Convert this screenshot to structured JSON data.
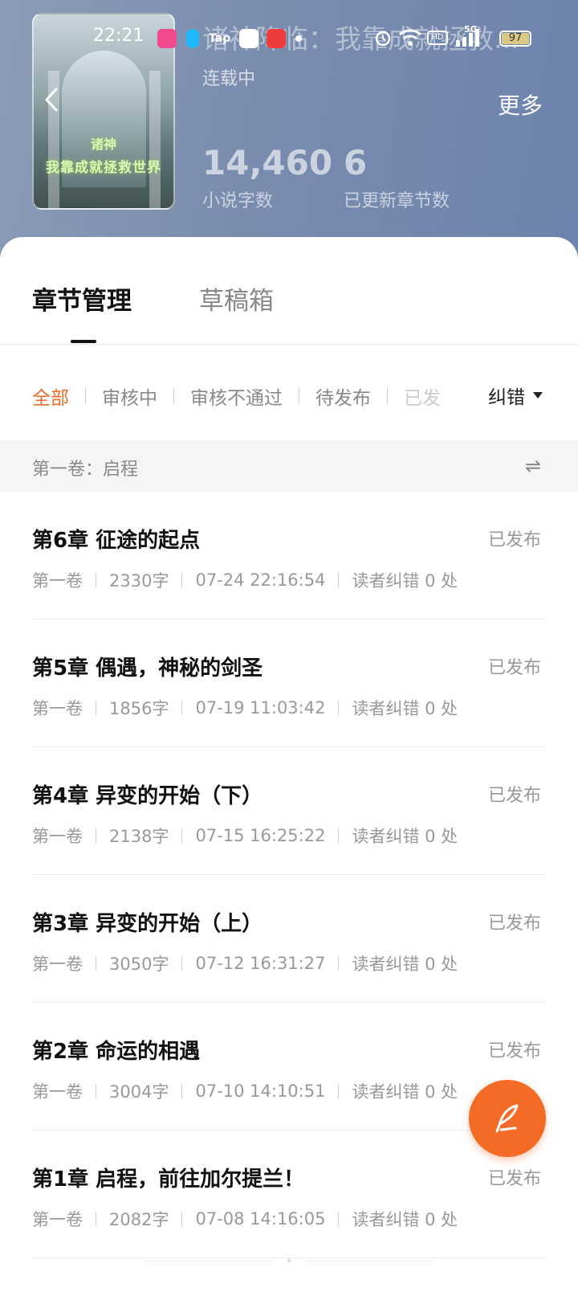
{
  "status_bar": {
    "time": "22:21",
    "battery": "97",
    "battery_percent": 97,
    "network": "5G",
    "hd": "HD"
  },
  "book": {
    "title": "诸神降临：我靠成就拯救...",
    "serial_status": "连载中",
    "cover_text_line1": "诸神",
    "cover_text_line2": "我靠成就拯救世界",
    "word_count": "14,460",
    "word_count_label": "小说字数",
    "chapter_count": "6",
    "chapter_count_label": "已更新章节数"
  },
  "header": {
    "more_label": "更多"
  },
  "tabs": [
    {
      "label": "章节管理",
      "active": true
    },
    {
      "label": "草稿箱",
      "active": false
    }
  ],
  "filters": {
    "items": [
      {
        "label": "全部",
        "active": true
      },
      {
        "label": "审核中",
        "active": false
      },
      {
        "label": "审核不通过",
        "active": false
      },
      {
        "label": "待发布",
        "active": false
      },
      {
        "label": "已发",
        "active": false
      }
    ],
    "correction_label": "纠错"
  },
  "volume": {
    "label": "第一卷：启程",
    "switch_icon": "⇌"
  },
  "chapters": [
    {
      "title": "第6章 征途的起点",
      "status": "已发布",
      "volume": "第一卷",
      "words": "2330字",
      "time": "07-24 22:16:54",
      "corrections": "读者纠错 0 处"
    },
    {
      "title": "第5章 偶遇，神秘的剑圣",
      "status": "已发布",
      "volume": "第一卷",
      "words": "1856字",
      "time": "07-19 11:03:42",
      "corrections": "读者纠错 0 处"
    },
    {
      "title": "第4章 异变的开始（下）",
      "status": "已发布",
      "volume": "第一卷",
      "words": "2138字",
      "time": "07-15 16:25:22",
      "corrections": "读者纠错 0 处"
    },
    {
      "title": "第3章 异变的开始（上）",
      "status": "已发布",
      "volume": "第一卷",
      "words": "3050字",
      "time": "07-12 16:31:27",
      "corrections": "读者纠错 0 处"
    },
    {
      "title": "第2章 命运的相遇",
      "status": "已发布",
      "volume": "第一卷",
      "words": "3004字",
      "time": "07-10 14:10:51",
      "corrections": "读者纠错 0 处"
    },
    {
      "title": "第1章 启程，前往加尔提兰！",
      "status": "已发布",
      "volume": "第一卷",
      "words": "2082字",
      "time": "07-08 14:16:05",
      "corrections": "读者纠错 0 处"
    }
  ],
  "colors": {
    "accent": "#f36b26",
    "active_filter": "#ee6a2a",
    "header_bg": "#7a8cae"
  },
  "icons": {
    "back": "chevron-left-icon",
    "fab": "quill-pen-icon",
    "swap": "swap-arrows-icon"
  }
}
